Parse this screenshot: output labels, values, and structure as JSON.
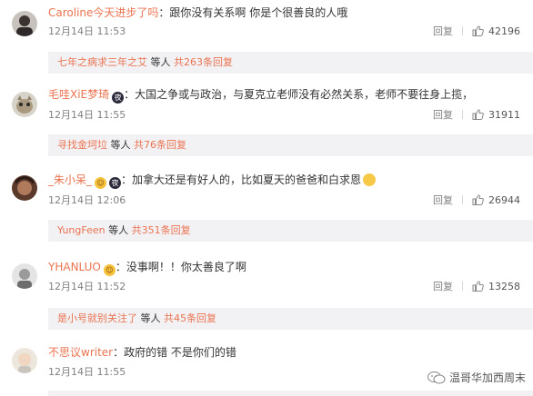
{
  "comments": [
    {
      "user": "Caroline今天进步了吗",
      "text": "：跟你没有关系啊 你是个很善良的人哦",
      "time": "12月14日 11:53",
      "reply": "回复",
      "likes": "42196",
      "sub_user": "七年之病求三年之艾",
      "sub_mid": " 等人 ",
      "sub_count": "共263条回复"
    },
    {
      "user": "毛哇XiE梦琦",
      "badge": "夜",
      "text": "：大国之争或与政治，与夏克立老师没有必然关系，老师不要往身上揽，",
      "time": "12月14日 11:55",
      "reply": "回复",
      "likes": "31911",
      "sub_user": "寻找金坷垃",
      "sub_mid": " 等人 ",
      "sub_count": "共76条回复"
    },
    {
      "user": "_朱小呆_",
      "badge": "夜",
      "text": "：加拿大还是有好人的，比如夏天的爸爸和白求恩",
      "time": "12月14日 12:06",
      "reply": "回复",
      "likes": "26944",
      "sub_user": "YungFeen",
      "sub_mid": " 等人 ",
      "sub_count": "共351条回复"
    },
    {
      "user": "YHANLUO",
      "text": "：没事啊！！你太善良了啊",
      "time": "12月14日 11:52",
      "reply": "回复",
      "likes": "13258",
      "sub_user": "是小号就别关注了",
      "sub_mid": " 等人 ",
      "sub_count": "共45条回复"
    },
    {
      "user": "不思议writer",
      "text": "：政府的错 不是你们的错",
      "time": "12月14日 11:55"
    }
  ],
  "watermark": "温哥华加西周末",
  "colors": {
    "username": "#eb7350",
    "subbox_bg": "#f2f2f5",
    "meta": "#808080"
  }
}
